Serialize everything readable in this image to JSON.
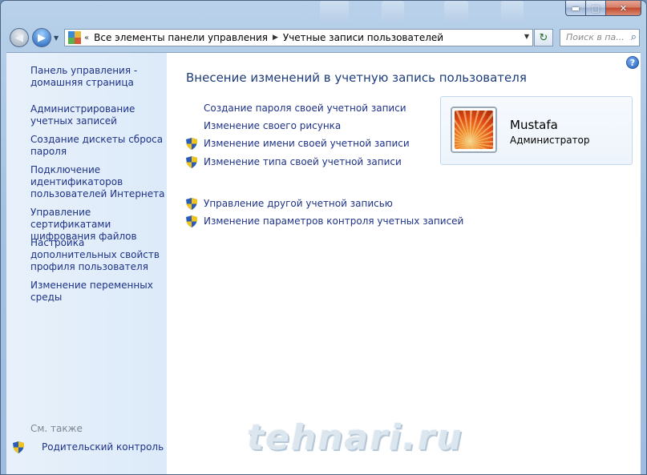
{
  "address_bar": {
    "crumbs": [
      "Все элементы панели управления",
      "Учетные записи пользователей"
    ]
  },
  "search": {
    "placeholder": "Поиск в па..."
  },
  "sidebar": {
    "items": [
      {
        "label": "Панель управления - домашняя страница"
      },
      {
        "label": "Администрирование учетных записей"
      },
      {
        "label": "Создание дискеты сброса пароля"
      },
      {
        "label": "Подключение идентификаторов пользователей Интернета"
      },
      {
        "label": "Управление сертификатами шифрования файлов"
      },
      {
        "label": "Настройка дополнительных свойств профиля пользователя"
      },
      {
        "label": "Изменение переменных среды"
      }
    ],
    "see_also": "См. также",
    "parental_control": "Родительский контроль"
  },
  "main": {
    "title": "Внесение изменений в учетную запись пользователя",
    "links": [
      {
        "label": "Создание пароля своей учетной записи",
        "shield": false
      },
      {
        "label": "Изменение своего рисунка",
        "shield": false
      },
      {
        "label": "Изменение имени своей учетной записи",
        "shield": true
      },
      {
        "label": "Изменение типа своей учетной записи",
        "shield": true
      },
      {
        "label": "Управление другой учетной записью",
        "shield": true
      },
      {
        "label": "Изменение параметров контроля учетных записей",
        "shield": true
      }
    ]
  },
  "user": {
    "name": "Mustafa",
    "role": "Администратор"
  },
  "watermark": "tehnari.ru",
  "colors": {
    "link": "#1e3287",
    "title": "#1e3c7b",
    "sidebar_bg": "#dceaf9"
  }
}
